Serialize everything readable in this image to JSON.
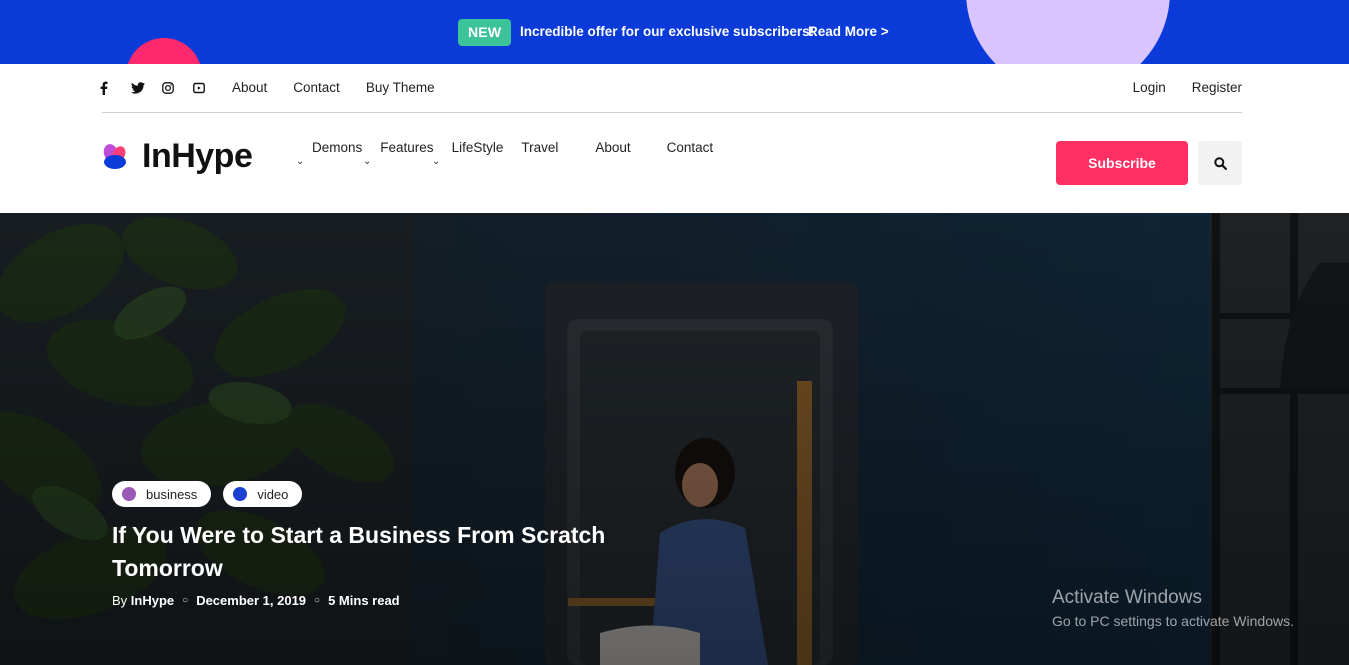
{
  "promo": {
    "badge": "NEW",
    "message": "Incredible offer for our exclusive subscribers!",
    "link": "Read More >"
  },
  "topbar": {
    "social_icons": [
      "facebook-icon",
      "twitter-icon",
      "instagram-icon",
      "youtube-icon"
    ],
    "links": [
      "About",
      "Contact",
      "Buy Theme"
    ],
    "auth": [
      "Login",
      "Register"
    ]
  },
  "header": {
    "logo": "InHype",
    "nav": [
      {
        "label": "Demons",
        "dropdown": true
      },
      {
        "label": "Features",
        "dropdown": true
      },
      {
        "label": "LifeStyle",
        "dropdown": true
      },
      {
        "label": "Travel",
        "dropdown": false
      },
      {
        "label": "About",
        "dropdown": false
      },
      {
        "label": "Contact",
        "dropdown": false
      }
    ],
    "subscribe": "Subscribe",
    "search_icon": "search-icon"
  },
  "hero": {
    "tags": [
      {
        "label": "business",
        "color": "#9b59b6"
      },
      {
        "label": "video",
        "color": "#1a3fd1"
      }
    ],
    "title": "If You Were to Start a Business From Scratch Tomorrow",
    "meta": {
      "author_prefix": "By",
      "author": "InHype",
      "date": "December 1, 2019",
      "read_time": "5 Mins read"
    }
  },
  "watermark": {
    "title": "Activate Windows",
    "subtitle": "Go to PC settings to activate Windows."
  },
  "colors": {
    "promo_bg": "#0a3ad8",
    "badge": "#3dc39a",
    "accent": "#ff2e63"
  }
}
